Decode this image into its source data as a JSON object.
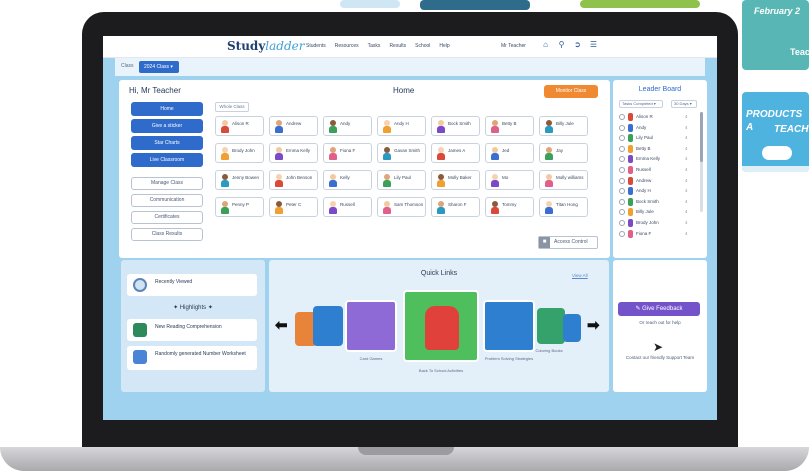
{
  "background": {
    "poster1": {
      "line1": "February 2",
      "line2": "Teach"
    },
    "poster2": {
      "line1": "PRODUCTS A",
      "line2": "TEACH"
    }
  },
  "nav": {
    "logo_main": "Study",
    "logo_accent": "ladder",
    "links": [
      "Students",
      "Resources",
      "Tasks",
      "Results",
      "School",
      "Help"
    ],
    "user": "Mr Teacher",
    "icons": [
      "home-icon",
      "search-icon",
      "logout-icon",
      "menu-icon"
    ]
  },
  "classbar": {
    "label": "Class",
    "selected": "2024 Class ▾"
  },
  "main": {
    "greeting": "Hi, Mr Teacher",
    "title": "Home",
    "monitor_button": "Monitor Class",
    "primary_buttons": [
      "Home",
      "Give a sticker",
      "Star Charts",
      "Live Classroom"
    ],
    "secondary_buttons": [
      "Manage Class",
      "Communication",
      "Certificates",
      "Class Results"
    ],
    "whole_class": "Whole Class",
    "access_control": "Access Control",
    "students": [
      [
        "Alison R",
        "Andrew",
        "Andy",
        "Andy H",
        "Bock Smith",
        "Betty B",
        "Billy Jule"
      ],
      [
        "Brody John",
        "Emma Kelly",
        "Fiona F",
        "Gavan Smith",
        "James A",
        "Jed",
        "Jay"
      ],
      [
        "Jenny Bowen",
        "John Benson",
        "Kelly",
        "Lily Paul",
        "Molly Baker",
        "Mo",
        "Molly williams"
      ],
      [
        "Penny P",
        "Peter C",
        "Russell",
        "Sam Thomson",
        "Sharon F",
        "Tommy",
        "Titan Hong"
      ]
    ]
  },
  "leaderboard": {
    "title": "Leader Board",
    "filter1": "Tasks Completed ▾",
    "filter2": "30 Days ▾",
    "rows": [
      {
        "name": "Alison R",
        "score": "4"
      },
      {
        "name": "Andy",
        "score": "4"
      },
      {
        "name": "Lily Paul",
        "score": "4"
      },
      {
        "name": "Betty B",
        "score": "4"
      },
      {
        "name": "Emma Kelly",
        "score": "4"
      },
      {
        "name": "Russell",
        "score": "4"
      },
      {
        "name": "Andrew",
        "score": "4"
      },
      {
        "name": "Andy H",
        "score": "4"
      },
      {
        "name": "Bock Smith",
        "score": "4"
      },
      {
        "name": "Billy Jule",
        "score": "4"
      },
      {
        "name": "Brody John",
        "score": "4"
      },
      {
        "name": "Fiona F",
        "score": "4"
      }
    ]
  },
  "recent": {
    "recently_viewed": "Recently Viewed",
    "highlights": "Highlights",
    "item1": "New Reading Comprehension",
    "item2": "Randomly generated Number Worksheet"
  },
  "quicklinks": {
    "title": "Quick Links",
    "view_all": "View All",
    "labels": [
      "Card Games",
      "Back To School Activities",
      "Problem Solving Strategies",
      "Coloring Books"
    ]
  },
  "feedback": {
    "button": "Give Feedback",
    "sub": "Or reach out for help",
    "contact": "Contact our friendly Support Team"
  }
}
